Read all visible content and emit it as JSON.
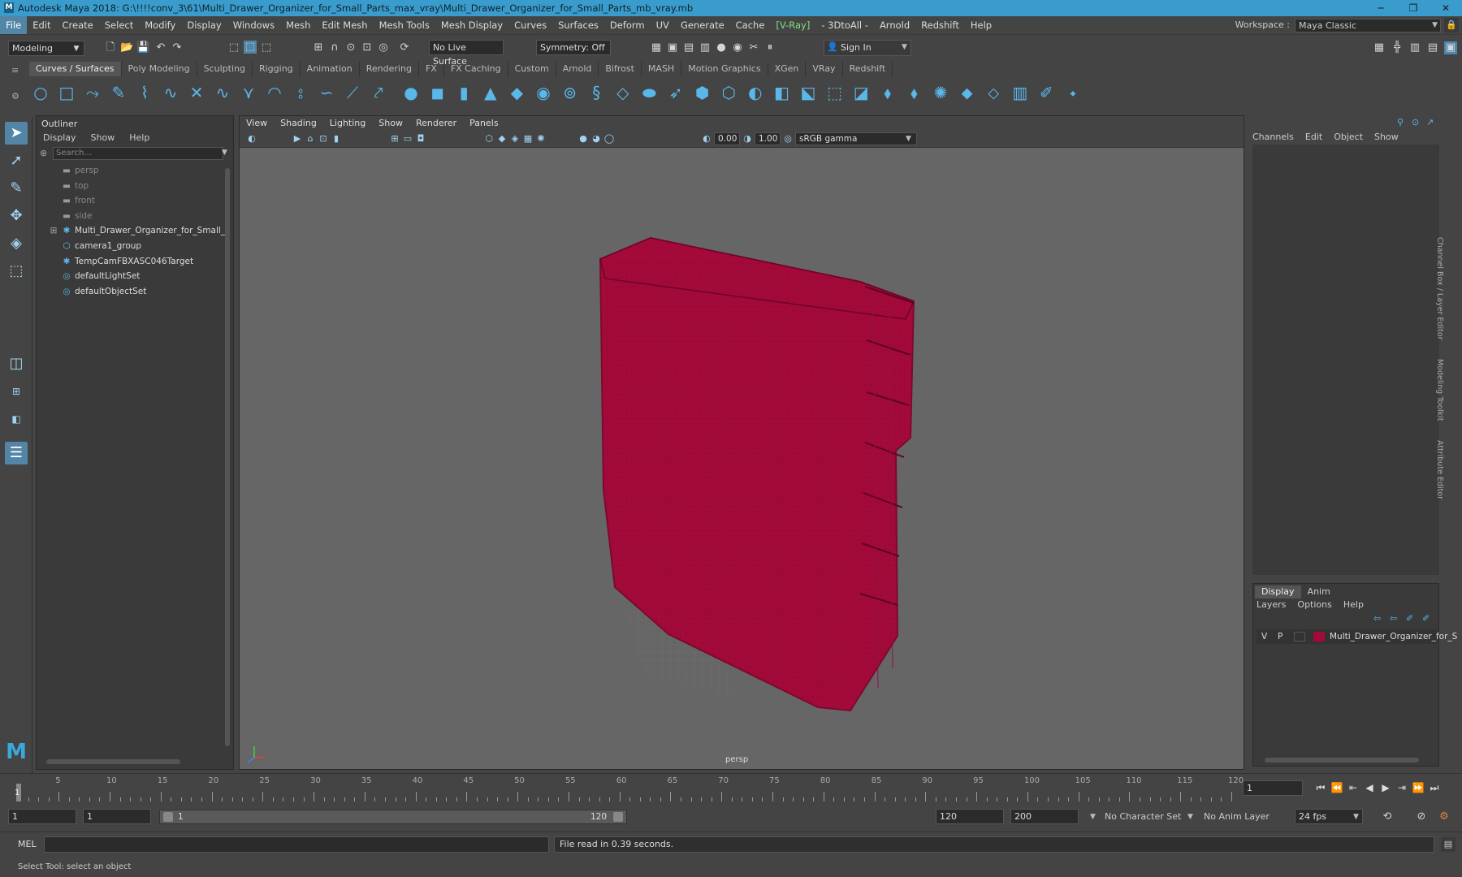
{
  "titlebar": {
    "title": "Autodesk Maya 2018: G:\\!!!!conv_3\\61\\Multi_Drawer_Organizer_for_Small_Parts_max_vray\\Multi_Drawer_Organizer_for_Small_Parts_mb_vray.mb"
  },
  "menubar": {
    "items": [
      "File",
      "Edit",
      "Create",
      "Select",
      "Modify",
      "Display",
      "Windows",
      "Mesh",
      "Edit Mesh",
      "Mesh Tools",
      "Mesh Display",
      "Curves",
      "Surfaces",
      "Deform",
      "UV",
      "Generate",
      "Cache",
      "[V-Ray]",
      "- 3DtoAll -",
      "Arnold",
      "Redshift",
      "Help"
    ],
    "workspace_label": "Workspace :",
    "workspace_value": "Maya Classic"
  },
  "statusline": {
    "mode": "Modeling",
    "live_surface": "No Live Surface",
    "symmetry": "Symmetry: Off",
    "sign_in": "Sign In"
  },
  "shelf": {
    "tabs": [
      "Curves / Surfaces",
      "Poly Modeling",
      "Sculpting",
      "Rigging",
      "Animation",
      "Rendering",
      "FX",
      "FX Caching",
      "Custom",
      "Arnold",
      "Bifrost",
      "MASH",
      "Motion Graphics",
      "XGen",
      "VRay",
      "Redshift"
    ],
    "active_tab": "Curves / Surfaces"
  },
  "outliner": {
    "title": "Outliner",
    "menu": [
      "Display",
      "Show",
      "Help"
    ],
    "search_placeholder": "Search...",
    "items": [
      {
        "label": "persp",
        "icon": "camera-icon",
        "dim": true
      },
      {
        "label": "top",
        "icon": "camera-icon",
        "dim": true
      },
      {
        "label": "front",
        "icon": "camera-icon",
        "dim": true
      },
      {
        "label": "side",
        "icon": "camera-icon",
        "dim": true
      },
      {
        "label": "Multi_Drawer_Organizer_for_Small_Pa",
        "icon": "transform-icon",
        "dim": false,
        "expandable": true
      },
      {
        "label": "camera1_group",
        "icon": "group-icon",
        "dim": false
      },
      {
        "label": "TempCamFBXASC046Target",
        "icon": "transform-icon",
        "dim": false
      },
      {
        "label": "defaultLightSet",
        "icon": "set-icon",
        "dim": false
      },
      {
        "label": "defaultObjectSet",
        "icon": "set-icon",
        "dim": false
      }
    ]
  },
  "viewport": {
    "menu": [
      "View",
      "Shading",
      "Lighting",
      "Show",
      "Renderer",
      "Panels"
    ],
    "exposure": "0.00",
    "gamma": "1.00",
    "color_space": "sRGB gamma",
    "camera_label": "persp",
    "wire_color": "#a30a3a"
  },
  "channelbox": {
    "menu": [
      "Channels",
      "Edit",
      "Object",
      "Show"
    ],
    "vertical_tabs": [
      "Channel Box / Layer Editor",
      "Modeling Toolkit",
      "Attribute Editor"
    ]
  },
  "layer_editor": {
    "tabs": [
      "Display",
      "Anim"
    ],
    "menu": [
      "Layers",
      "Options",
      "Help"
    ],
    "layer": {
      "v": "V",
      "p": "P",
      "name": "Multi_Drawer_Organizer_for_S",
      "color": "#a30a3a"
    }
  },
  "timeslider": {
    "ticks": [
      5,
      10,
      15,
      20,
      25,
      30,
      35,
      40,
      45,
      50,
      55,
      60,
      65,
      70,
      75,
      80,
      85,
      90,
      95,
      100,
      105,
      110,
      115,
      120
    ],
    "current_frame": "1",
    "frame_field": "1"
  },
  "rangeslider": {
    "start": "1",
    "start2": "1",
    "range_start": "1",
    "range_end": "120",
    "end": "120",
    "end2": "200",
    "character_set": "No Character Set",
    "anim_layer": "No Anim Layer",
    "fps": "24 fps"
  },
  "cmdline": {
    "label": "MEL",
    "result": "File read in  0.39 seconds."
  },
  "helpline": {
    "text": "Select Tool: select an object"
  }
}
